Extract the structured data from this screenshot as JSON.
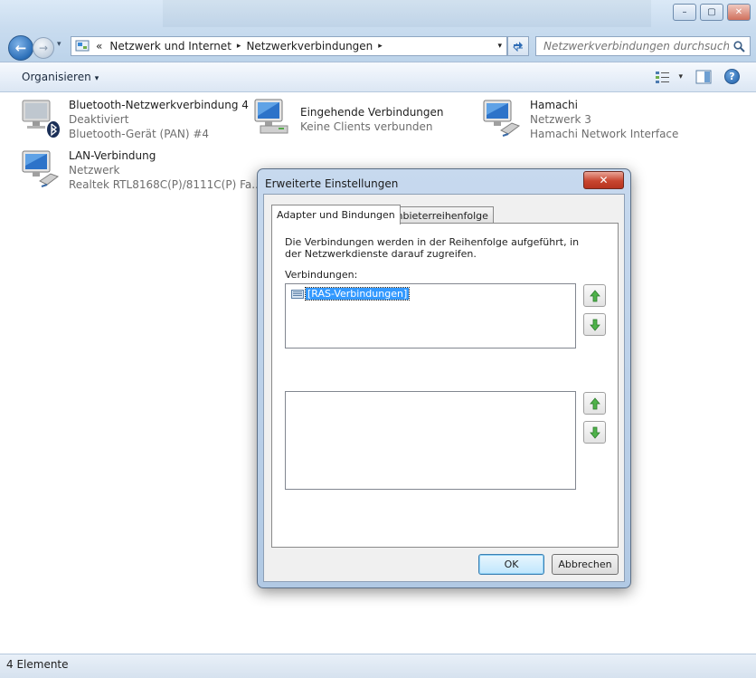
{
  "window": {
    "minimize_glyph": "–",
    "maximize_glyph": "▢",
    "close_glyph": "✕"
  },
  "navigation": {
    "back_glyph": "←",
    "forward_glyph": "→",
    "dropdown_glyph": "▾"
  },
  "address_bar": {
    "overflow": "«",
    "crumbs": [
      "Netzwerk und Internet",
      "Netzwerkverbindungen"
    ],
    "separator": "▸",
    "dropdown_glyph": "▾"
  },
  "search": {
    "placeholder": "Netzwerkverbindungen durchsuchen"
  },
  "command_bar": {
    "organize_label": "Organisieren",
    "caret": "▾",
    "help_glyph": "?"
  },
  "items": [
    {
      "title": "Bluetooth-Netzwerkverbindung 4",
      "line1": "Deaktiviert",
      "line2": "Bluetooth-Gerät (PAN) #4",
      "icon": "bluetooth-network-icon"
    },
    {
      "title": "Eingehende Verbindungen",
      "line1": "Keine Clients verbunden",
      "icon": "incoming-connections-icon"
    },
    {
      "title": "Hamachi",
      "line1": "Netzwerk  3",
      "line2": "Hamachi Network Interface",
      "icon": "network-adapter-icon"
    },
    {
      "title": "LAN-Verbindung",
      "line1": "Netzwerk",
      "line2": "Realtek RTL8168C(P)/8111C(P) Fa...",
      "icon": "network-adapter-icon"
    }
  ],
  "status_bar": {
    "text": "4 Elemente"
  },
  "dialog": {
    "title": "Erweiterte Einstellungen",
    "close_glyph": "✕",
    "tabs": [
      "Adapter und Bindungen",
      "Anbieterreihenfolge"
    ],
    "description": "Die Verbindungen werden in der Reihenfolge aufgeführt, in der Netzwerkdienste darauf zugreifen.",
    "connections_label": "Verbindungen:",
    "connections": [
      "[RAS-Verbindungen]"
    ],
    "ok_label": "OK",
    "cancel_label": "Abbrechen"
  },
  "colors": {
    "accent": "#3399ff",
    "chrome": "#c9dcef",
    "close_red": "#c8452f"
  }
}
